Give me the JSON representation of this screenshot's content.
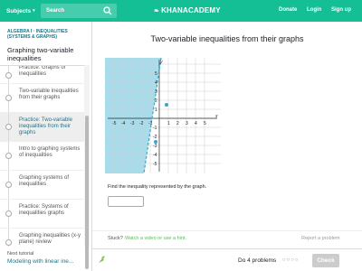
{
  "header": {
    "subjects_label": "Subjects",
    "search_placeholder": "Search",
    "logo_text": "KHANACADEMY",
    "donate": "Donate",
    "login": "Login",
    "signup": "Sign up",
    "brand_color": "#14bf96"
  },
  "sidebar": {
    "breadcrumb_line1": "ALGEBRA I · INEQUALITIES",
    "breadcrumb_line2": "(SYSTEMS & GRAPHS)",
    "title": "Graphing two-variable inequalities",
    "items": [
      {
        "label": "Practice: Graphs of inequalities",
        "state": "partial"
      },
      {
        "label": "Two-variable inequalities from their graphs",
        "state": "normal"
      },
      {
        "label": "Practice: Two-variable inequalities from their graphs",
        "state": "active"
      },
      {
        "label": "Intro to graphing systems of inequalities",
        "state": "normal"
      },
      {
        "label": "Graphing systems of inequalities",
        "state": "normal"
      },
      {
        "label": "Practice: Systems of inequalities graphs",
        "state": "normal"
      },
      {
        "label": "Graphing inequalities (x-y plane) review",
        "state": "normal"
      }
    ],
    "next_tutorial_label": "Next tutorial",
    "next_tutorial_link": "Modeling with linear ine..."
  },
  "exercise": {
    "title": "Two-variable inequalities from their graphs",
    "graph": {
      "x_ticks": [
        "-5",
        "-4",
        "-3",
        "-2",
        "-1",
        "1",
        "2",
        "3",
        "4",
        "5"
      ],
      "y_ticks": [
        "5",
        "4",
        "3",
        "2",
        "1",
        "-1",
        "-2",
        "-3",
        "-4",
        "-5"
      ],
      "x_axis_label": "x",
      "y_axis_label": "y",
      "shade_color": "#9fd8e8",
      "boundary_color": "#3aa6c9"
    },
    "prompt": "Find the inequality represented by the graph.",
    "answer_value": "",
    "stuck_label": "Stuck?",
    "hint_link": "Watch a video or use a hint.",
    "report_label": "Report a problem"
  },
  "footer": {
    "progress_text": "Do 4 problems",
    "dots": "○○○○",
    "check_label": "Check"
  }
}
